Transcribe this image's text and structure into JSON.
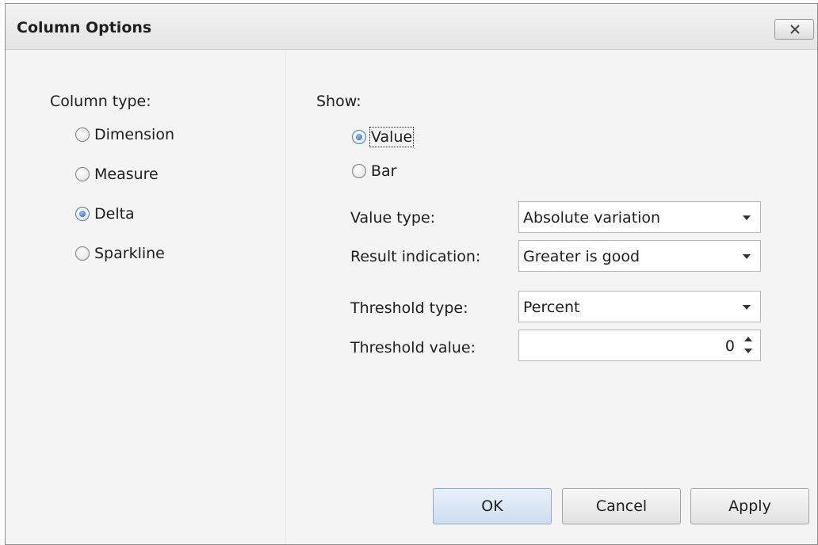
{
  "dialog": {
    "title": "Column Options",
    "close_icon": "close-x-icon"
  },
  "column_type": {
    "label": "Column type:",
    "options": [
      {
        "label": "Dimension",
        "checked": false
      },
      {
        "label": "Measure",
        "checked": false
      },
      {
        "label": "Delta",
        "checked": true
      },
      {
        "label": "Sparkline",
        "checked": false
      }
    ]
  },
  "show": {
    "label": "Show:",
    "options": [
      {
        "label": "Value",
        "checked": true
      },
      {
        "label": "Bar",
        "checked": false
      }
    ]
  },
  "fields": {
    "value_type": {
      "label": "Value type:",
      "value": "Absolute variation"
    },
    "result_indication": {
      "label": "Result indication:",
      "value": "Greater is good"
    },
    "threshold_type": {
      "label": "Threshold type:",
      "value": "Percent"
    },
    "threshold_value": {
      "label": "Threshold value:",
      "value": "0"
    }
  },
  "buttons": {
    "ok": "OK",
    "cancel": "Cancel",
    "apply": "Apply"
  },
  "colors": {
    "accent": "#3f73bd",
    "default_button": "#cfdcf0"
  }
}
